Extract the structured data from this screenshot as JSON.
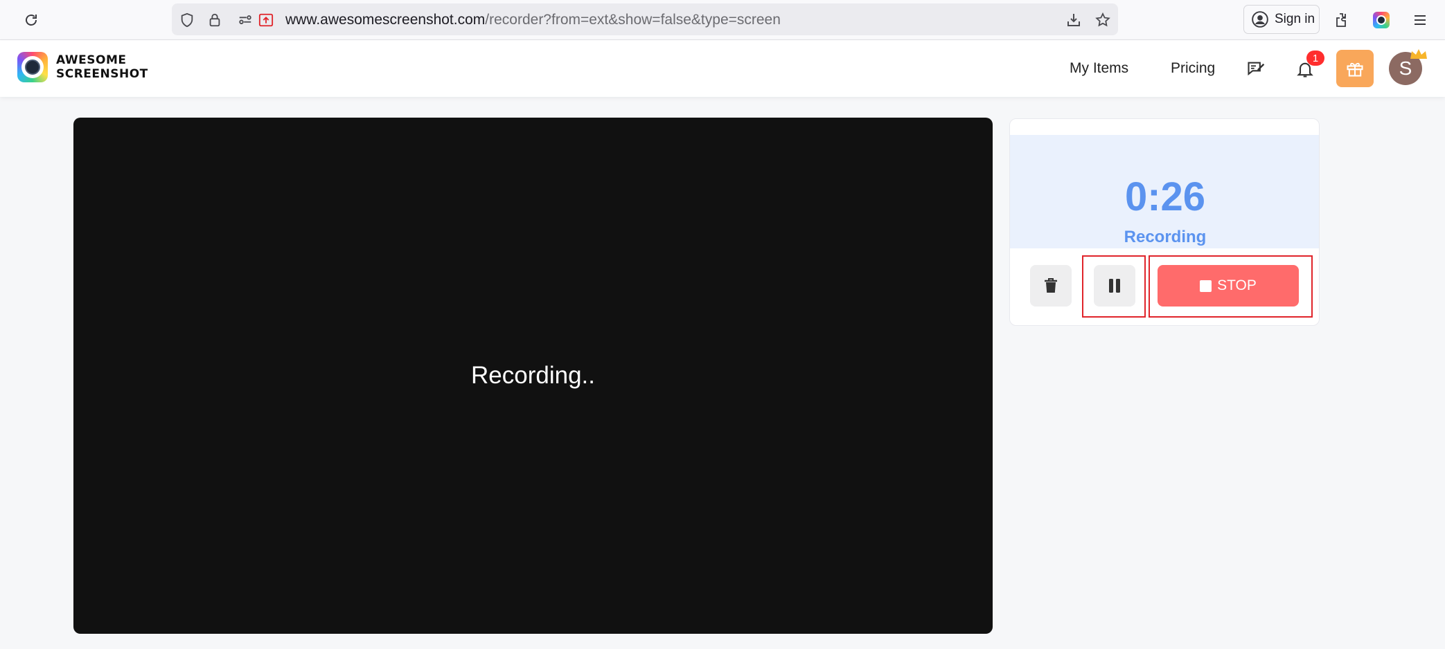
{
  "browser": {
    "url_host": "www.awesomescreenshot.com",
    "url_path": "/recorder?from=ext&show=false&type=screen",
    "signin_label": "Sign in"
  },
  "header": {
    "logo_line1": "AWESOME",
    "logo_line2": "SCREENSHOT",
    "nav": {
      "my_items": "My Items",
      "pricing": "Pricing"
    },
    "notification_count": "1",
    "avatar_initial": "S"
  },
  "preview": {
    "status_text": "Recording.."
  },
  "panel": {
    "timer": "0:26",
    "status": "Recording",
    "stop_label": "STOP"
  },
  "colors": {
    "accent_blue": "#5b93ef",
    "stop_red": "#ff6b6b",
    "gift_orange": "#f9a75a",
    "highlight_red": "#e0242a"
  },
  "icons": [
    "reload-icon",
    "shield-icon",
    "lock-icon",
    "permissions-icon",
    "upload-icon",
    "download-icon",
    "star-icon",
    "account-icon",
    "extensions-icon",
    "colorful-extension-icon",
    "menu-icon",
    "feedback-icon",
    "bell-icon",
    "gift-icon",
    "crown-icon",
    "trash-icon",
    "pause-icon",
    "stop-square-icon"
  ]
}
